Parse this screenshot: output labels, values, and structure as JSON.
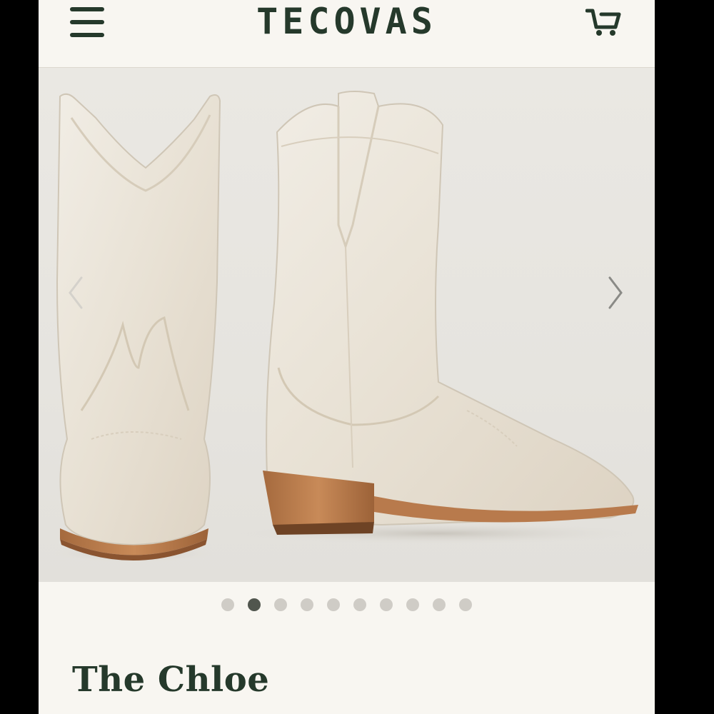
{
  "header": {
    "brand": "TECOVAS",
    "menu_icon": "hamburger-menu-icon",
    "cart_icon": "shopping-cart-icon"
  },
  "gallery": {
    "image_description": "Two white cowboy boots with stitched shafts and stacked leather heels",
    "prev_icon": "chevron-left-icon",
    "next_icon": "chevron-right-icon",
    "slide_count": 10,
    "active_index": 1
  },
  "product": {
    "name": "The Chloe"
  },
  "colors": {
    "brand_green": "#25392b",
    "background": "#f8f6f1",
    "dot_inactive": "#cfccc6",
    "dot_active": "#51564e"
  }
}
